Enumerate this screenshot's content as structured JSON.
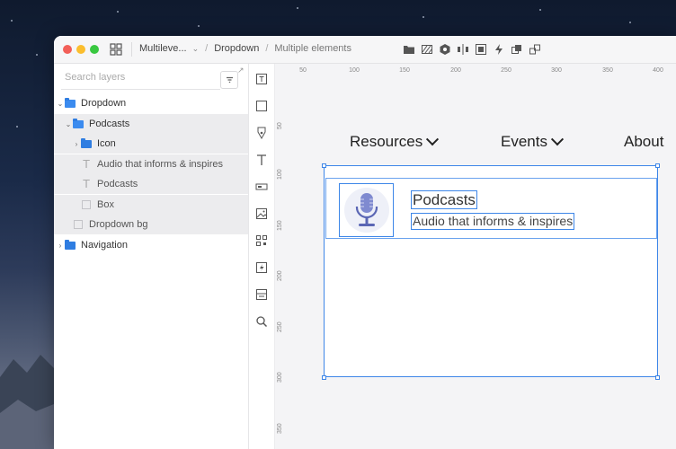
{
  "breadcrumb": {
    "project": "Multileve...",
    "page": "Dropdown",
    "selection": "Multiple elements"
  },
  "layers": {
    "search_placeholder": "Search layers",
    "rows": [
      {
        "label": "Dropdown",
        "kind": "folder",
        "caret": "open",
        "depth": 0
      },
      {
        "label": "Podcasts",
        "kind": "folder",
        "caret": "open",
        "depth": 1
      },
      {
        "label": "Icon",
        "kind": "folder",
        "caret": "closed",
        "depth": 2
      },
      {
        "label": "Audio that informs & inspires",
        "kind": "text",
        "depth": 2
      },
      {
        "label": "Podcasts",
        "kind": "text",
        "depth": 2
      },
      {
        "label": "Box",
        "kind": "box",
        "depth": 2
      },
      {
        "label": "Dropdown bg",
        "kind": "box",
        "depth": 1
      },
      {
        "label": "Navigation",
        "kind": "folder",
        "caret": "closed",
        "depth": 0
      }
    ]
  },
  "ruler": {
    "top": [
      "50",
      "100",
      "150",
      "200",
      "250",
      "300",
      "350",
      "400"
    ],
    "left": [
      "50",
      "100",
      "150",
      "200",
      "250",
      "300",
      "350"
    ]
  },
  "canvas": {
    "nav": [
      "Resources",
      "Events",
      "About"
    ],
    "item_title": "Podcasts",
    "item_subtitle": "Audio that informs & inspires"
  },
  "colors": {
    "selection": "#3d86e8",
    "folder": "#2f7de1",
    "mic": "#6a78c2"
  }
}
